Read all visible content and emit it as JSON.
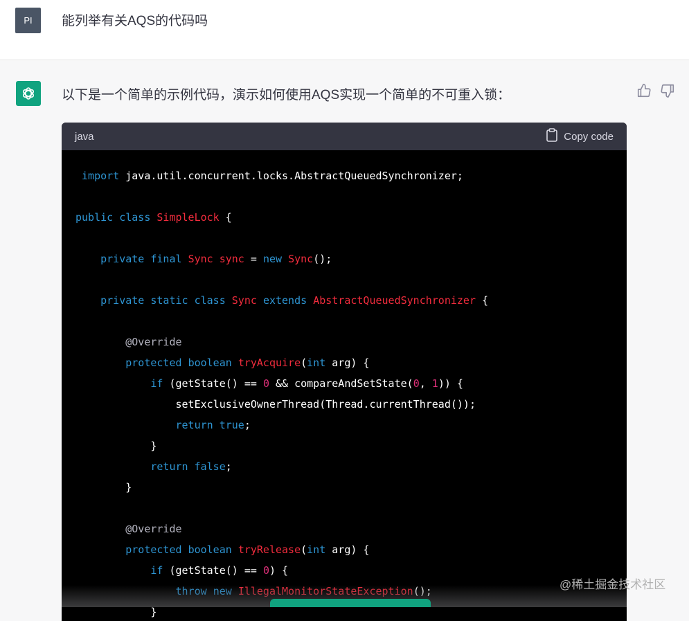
{
  "user_message": {
    "avatar_initials": "PI",
    "text": "能列举有关AQS的代码吗"
  },
  "assistant_message": {
    "intro": "以下是一个简单的示例代码，演示如何使用AQS实现一个简单的不可重入锁：",
    "code_language": "java",
    "copy_label": "Copy code"
  },
  "watermark": "@稀土掘金技术社区",
  "colors": {
    "brand": "#10a37f",
    "code_keyword": "#2e95d3",
    "code_type": "#f22c3d",
    "code_number": "#df3079"
  },
  "code_lines": [
    " import java.util.concurrent.locks.AbstractQueuedSynchronizer;",
    "",
    "public class SimpleLock {",
    "",
    "    private final Sync sync = new Sync();",
    "",
    "    private static class Sync extends AbstractQueuedSynchronizer {",
    "",
    "        @Override",
    "        protected boolean tryAcquire(int arg) {",
    "            if (getState() == 0 && compareAndSetState(0, 1)) {",
    "                setExclusiveOwnerThread(Thread.currentThread());",
    "                return true;",
    "            }",
    "            return false;",
    "        }",
    "",
    "        @Override",
    "        protected boolean tryRelease(int arg) {",
    "            if (getState() == 0) {",
    "                throw new IllegalMonitorStateException();",
    "            }"
  ]
}
